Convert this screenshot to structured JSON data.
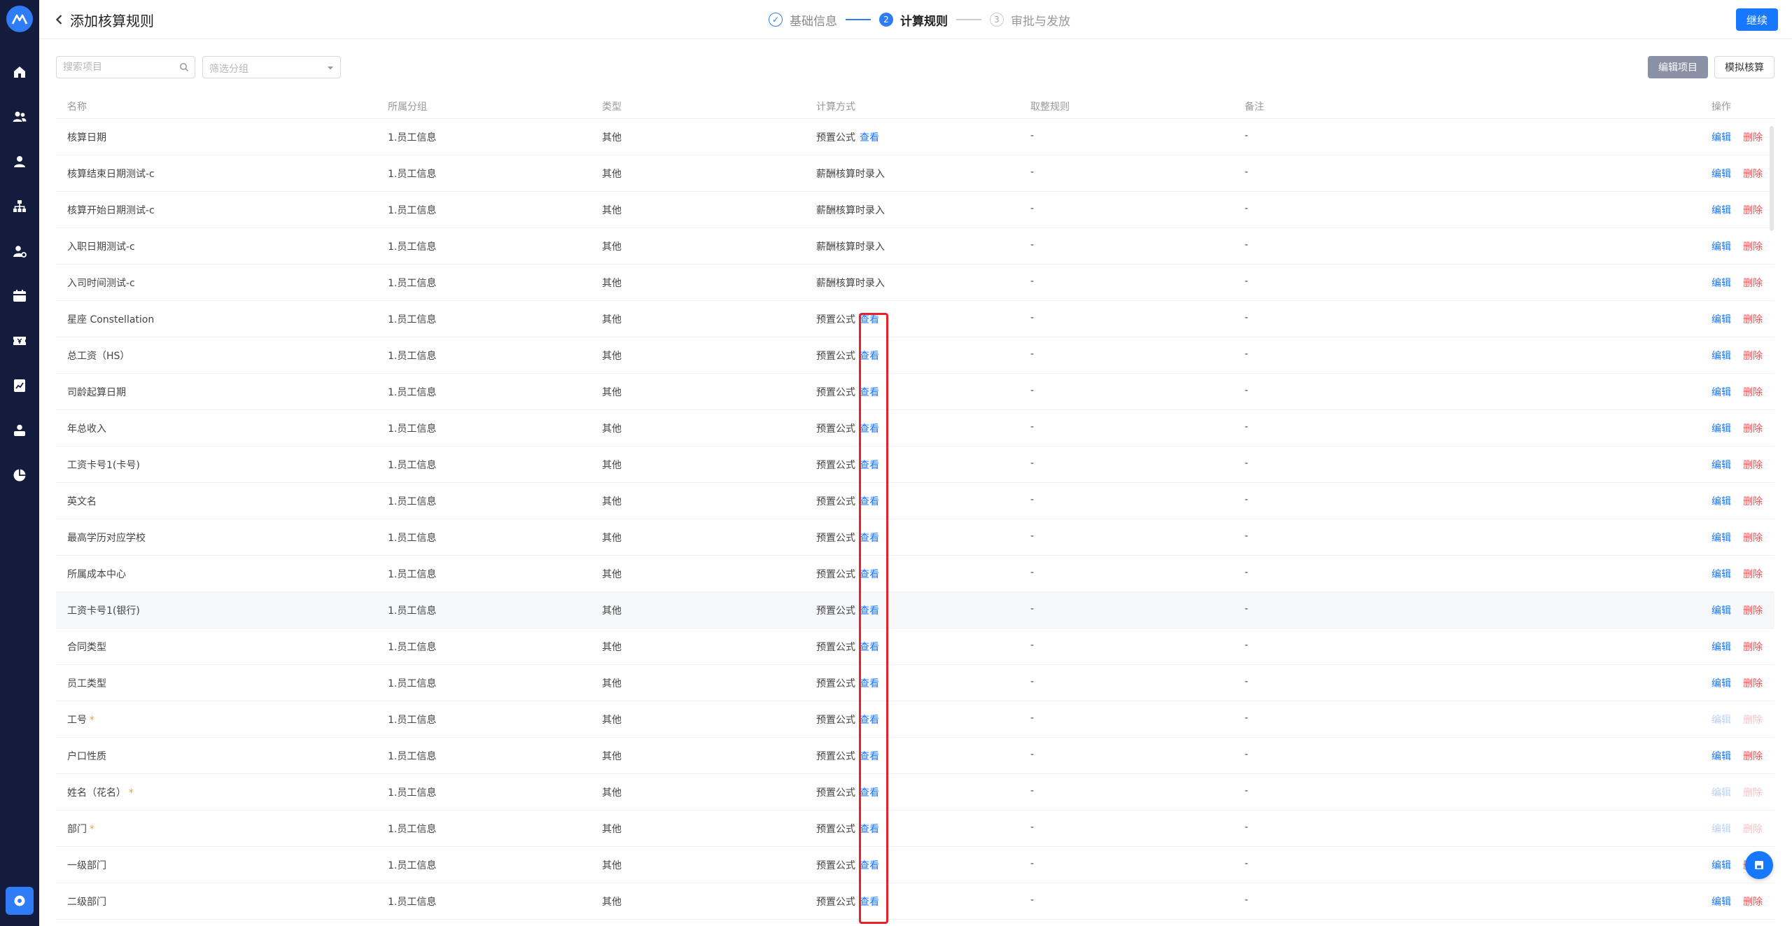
{
  "header": {
    "title": "添加核算规则",
    "steps": [
      {
        "num": "✓",
        "label": "基础信息",
        "state": "done"
      },
      {
        "num": "2",
        "label": "计算规则",
        "state": "active"
      },
      {
        "num": "3",
        "label": "审批与发放",
        "state": "todo"
      }
    ],
    "continue_label": "继续"
  },
  "sidebar": {
    "icons": [
      "home-icon",
      "team-icon",
      "user-icon",
      "org-chart-icon",
      "user-setting-icon",
      "calendar-icon",
      "ticket-icon",
      "report-icon",
      "person-icon",
      "pie-chart-icon"
    ]
  },
  "toolbar": {
    "search_placeholder": "搜索项目",
    "group_placeholder": "筛选分组",
    "edit_items_label": "编辑项目",
    "simulate_label": "模拟核算"
  },
  "table": {
    "columns": [
      "名称",
      "所属分组",
      "类型",
      "计算方式",
      "取整规则",
      "备注",
      "操作"
    ],
    "view_label": "查看",
    "edit_label": "编辑",
    "delete_label": "删除",
    "rows": [
      {
        "name": "核算日期",
        "required": false,
        "group": "1.员工信息",
        "type": "其他",
        "calc": "预置公式",
        "view": true,
        "round": "-",
        "note": "-",
        "disabled": false
      },
      {
        "name": "核算结束日期测试-c",
        "required": false,
        "group": "1.员工信息",
        "type": "其他",
        "calc": "薪酬核算时录入",
        "view": false,
        "round": "-",
        "note": "-",
        "disabled": false
      },
      {
        "name": "核算开始日期测试-c",
        "required": false,
        "group": "1.员工信息",
        "type": "其他",
        "calc": "薪酬核算时录入",
        "view": false,
        "round": "-",
        "note": "-",
        "disabled": false
      },
      {
        "name": "入职日期测试-c",
        "required": false,
        "group": "1.员工信息",
        "type": "其他",
        "calc": "薪酬核算时录入",
        "view": false,
        "round": "-",
        "note": "-",
        "disabled": false
      },
      {
        "name": "入司时间测试-c",
        "required": false,
        "group": "1.员工信息",
        "type": "其他",
        "calc": "薪酬核算时录入",
        "view": false,
        "round": "-",
        "note": "-",
        "disabled": false
      },
      {
        "name": "星座 Constellation",
        "required": false,
        "group": "1.员工信息",
        "type": "其他",
        "calc": "预置公式",
        "view": true,
        "round": "-",
        "note": "-",
        "disabled": false
      },
      {
        "name": "总工资（HS）",
        "required": false,
        "group": "1.员工信息",
        "type": "其他",
        "calc": "预置公式",
        "view": true,
        "round": "-",
        "note": "-",
        "disabled": false
      },
      {
        "name": "司龄起算日期",
        "required": false,
        "group": "1.员工信息",
        "type": "其他",
        "calc": "预置公式",
        "view": true,
        "round": "-",
        "note": "-",
        "disabled": false
      },
      {
        "name": "年总收入",
        "required": false,
        "group": "1.员工信息",
        "type": "其他",
        "calc": "预置公式",
        "view": true,
        "round": "-",
        "note": "-",
        "disabled": false
      },
      {
        "name": "工资卡号1(卡号)",
        "required": false,
        "group": "1.员工信息",
        "type": "其他",
        "calc": "预置公式",
        "view": true,
        "round": "-",
        "note": "-",
        "disabled": false
      },
      {
        "name": "英文名",
        "required": false,
        "group": "1.员工信息",
        "type": "其他",
        "calc": "预置公式",
        "view": true,
        "round": "-",
        "note": "-",
        "disabled": false
      },
      {
        "name": "最高学历对应学校",
        "required": false,
        "group": "1.员工信息",
        "type": "其他",
        "calc": "预置公式",
        "view": true,
        "round": "-",
        "note": "-",
        "disabled": false
      },
      {
        "name": "所属成本中心",
        "required": false,
        "group": "1.员工信息",
        "type": "其他",
        "calc": "预置公式",
        "view": true,
        "round": "-",
        "note": "-",
        "disabled": false
      },
      {
        "name": "工资卡号1(银行)",
        "required": false,
        "group": "1.员工信息",
        "type": "其他",
        "calc": "预置公式",
        "view": true,
        "round": "-",
        "note": "-",
        "disabled": false,
        "highlight": true
      },
      {
        "name": "合同类型",
        "required": false,
        "group": "1.员工信息",
        "type": "其他",
        "calc": "预置公式",
        "view": true,
        "round": "-",
        "note": "-",
        "disabled": false
      },
      {
        "name": "员工类型",
        "required": false,
        "group": "1.员工信息",
        "type": "其他",
        "calc": "预置公式",
        "view": true,
        "round": "-",
        "note": "-",
        "disabled": false
      },
      {
        "name": "工号",
        "required": true,
        "group": "1.员工信息",
        "type": "其他",
        "calc": "预置公式",
        "view": true,
        "round": "-",
        "note": "-",
        "disabled": true
      },
      {
        "name": "户口性质",
        "required": false,
        "group": "1.员工信息",
        "type": "其他",
        "calc": "预置公式",
        "view": true,
        "round": "-",
        "note": "-",
        "disabled": false
      },
      {
        "name": "姓名（花名）",
        "required": true,
        "group": "1.员工信息",
        "type": "其他",
        "calc": "预置公式",
        "view": true,
        "round": "-",
        "note": "-",
        "disabled": true
      },
      {
        "name": "部门",
        "required": true,
        "group": "1.员工信息",
        "type": "其他",
        "calc": "预置公式",
        "view": true,
        "round": "-",
        "note": "-",
        "disabled": true
      },
      {
        "name": "一级部门",
        "required": false,
        "group": "1.员工信息",
        "type": "其他",
        "calc": "预置公式",
        "view": true,
        "round": "-",
        "note": "-",
        "disabled": false
      },
      {
        "name": "二级部门",
        "required": false,
        "group": "1.员工信息",
        "type": "其他",
        "calc": "预置公式",
        "view": true,
        "round": "-",
        "note": "-",
        "disabled": false
      }
    ]
  },
  "colors": {
    "rail_bg": "#141c3d",
    "primary": "#1677ff",
    "danger": "#ff4d4f",
    "highlight_box": "#e8222b"
  }
}
